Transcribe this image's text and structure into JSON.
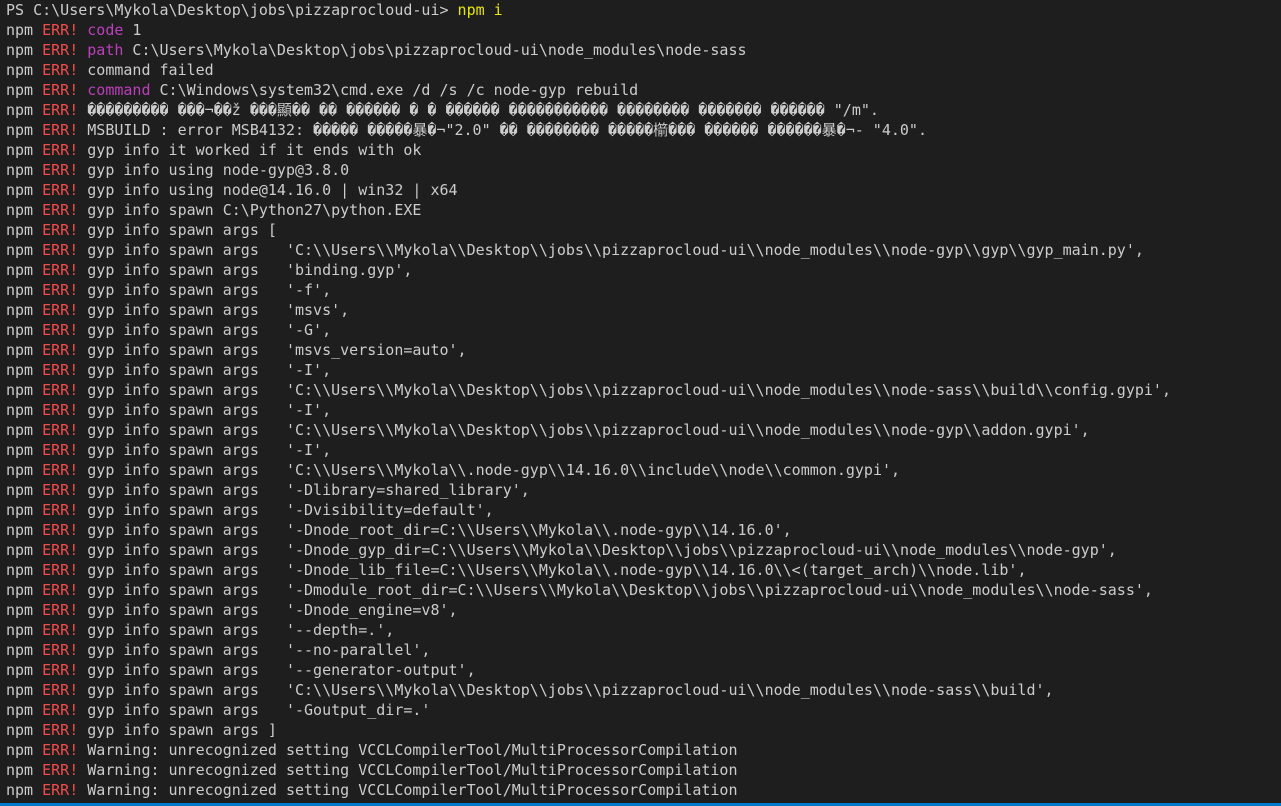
{
  "terminal": {
    "prompt": "PS C:\\Users\\Mykola\\Desktop\\jobs\\pizzaprocloud-ui> ",
    "command": "npm i",
    "colors": {
      "background": "#1e1e1e",
      "default": "#cccccc",
      "err": "#f14c4c",
      "keyword": "#bc3fbc",
      "cmd": "#e5e510",
      "statusbar": "#007acc"
    },
    "lines": [
      [
        {
          "t": "PS C:\\Users\\Mykola\\Desktop\\jobs\\pizzaprocloud-ui> ",
          "c": "default"
        },
        {
          "t": "npm i",
          "c": "cmd"
        }
      ],
      [
        {
          "t": "npm ",
          "c": "default"
        },
        {
          "t": "ERR!",
          "c": "err"
        },
        {
          "t": " ",
          "c": "default"
        },
        {
          "t": "code",
          "c": "keyword"
        },
        {
          "t": " 1",
          "c": "default"
        }
      ],
      [
        {
          "t": "npm ",
          "c": "default"
        },
        {
          "t": "ERR!",
          "c": "err"
        },
        {
          "t": " ",
          "c": "default"
        },
        {
          "t": "path",
          "c": "keyword"
        },
        {
          "t": " C:\\Users\\Mykola\\Desktop\\jobs\\pizzaprocloud-ui\\node_modules\\node-sass",
          "c": "default"
        }
      ],
      [
        {
          "t": "npm ",
          "c": "default"
        },
        {
          "t": "ERR!",
          "c": "err"
        },
        {
          "t": " command failed",
          "c": "default"
        }
      ],
      [
        {
          "t": "npm ",
          "c": "default"
        },
        {
          "t": "ERR!",
          "c": "err"
        },
        {
          "t": " ",
          "c": "default"
        },
        {
          "t": "command",
          "c": "keyword"
        },
        {
          "t": " C:\\Windows\\system32\\cmd.exe /d /s /c node-gyp rebuild",
          "c": "default"
        }
      ],
      [
        {
          "t": "npm ",
          "c": "default"
        },
        {
          "t": "ERR!",
          "c": "err"
        },
        {
          "t": " ��������� ���¬��ž ���顯�� �� ������ � � ������ ����������� �������� ������� ������ \"/m\".",
          "c": "default"
        }
      ],
      [
        {
          "t": "npm ",
          "c": "default"
        },
        {
          "t": "ERR!",
          "c": "err"
        },
        {
          "t": " MSBUILD : error MSB4132: ����� �����暴�¬\"2.0\" �� �������� �����櫤��� ������ ������暴�¬- \"4.0\".",
          "c": "default"
        }
      ],
      [
        {
          "t": "npm ",
          "c": "default"
        },
        {
          "t": "ERR!",
          "c": "err"
        },
        {
          "t": " gyp info it worked if it ends with ok",
          "c": "default"
        }
      ],
      [
        {
          "t": "npm ",
          "c": "default"
        },
        {
          "t": "ERR!",
          "c": "err"
        },
        {
          "t": " gyp info using node-gyp@3.8.0",
          "c": "default"
        }
      ],
      [
        {
          "t": "npm ",
          "c": "default"
        },
        {
          "t": "ERR!",
          "c": "err"
        },
        {
          "t": " gyp info using node@14.16.0 | win32 | x64",
          "c": "default"
        }
      ],
      [
        {
          "t": "npm ",
          "c": "default"
        },
        {
          "t": "ERR!",
          "c": "err"
        },
        {
          "t": " gyp info spawn C:\\Python27\\python.EXE",
          "c": "default"
        }
      ],
      [
        {
          "t": "npm ",
          "c": "default"
        },
        {
          "t": "ERR!",
          "c": "err"
        },
        {
          "t": " gyp info spawn args [",
          "c": "default"
        }
      ],
      [
        {
          "t": "npm ",
          "c": "default"
        },
        {
          "t": "ERR!",
          "c": "err"
        },
        {
          "t": " gyp info spawn args   'C:\\\\Users\\\\Mykola\\\\Desktop\\\\jobs\\\\pizzaprocloud-ui\\\\node_modules\\\\node-gyp\\\\gyp\\\\gyp_main.py',",
          "c": "default"
        }
      ],
      [
        {
          "t": "npm ",
          "c": "default"
        },
        {
          "t": "ERR!",
          "c": "err"
        },
        {
          "t": " gyp info spawn args   'binding.gyp',",
          "c": "default"
        }
      ],
      [
        {
          "t": "npm ",
          "c": "default"
        },
        {
          "t": "ERR!",
          "c": "err"
        },
        {
          "t": " gyp info spawn args   '-f',",
          "c": "default"
        }
      ],
      [
        {
          "t": "npm ",
          "c": "default"
        },
        {
          "t": "ERR!",
          "c": "err"
        },
        {
          "t": " gyp info spawn args   'msvs',",
          "c": "default"
        }
      ],
      [
        {
          "t": "npm ",
          "c": "default"
        },
        {
          "t": "ERR!",
          "c": "err"
        },
        {
          "t": " gyp info spawn args   '-G',",
          "c": "default"
        }
      ],
      [
        {
          "t": "npm ",
          "c": "default"
        },
        {
          "t": "ERR!",
          "c": "err"
        },
        {
          "t": " gyp info spawn args   'msvs_version=auto',",
          "c": "default"
        }
      ],
      [
        {
          "t": "npm ",
          "c": "default"
        },
        {
          "t": "ERR!",
          "c": "err"
        },
        {
          "t": " gyp info spawn args   '-I',",
          "c": "default"
        }
      ],
      [
        {
          "t": "npm ",
          "c": "default"
        },
        {
          "t": "ERR!",
          "c": "err"
        },
        {
          "t": " gyp info spawn args   'C:\\\\Users\\\\Mykola\\\\Desktop\\\\jobs\\\\pizzaprocloud-ui\\\\node_modules\\\\node-sass\\\\build\\\\config.gypi',",
          "c": "default"
        }
      ],
      [
        {
          "t": "npm ",
          "c": "default"
        },
        {
          "t": "ERR!",
          "c": "err"
        },
        {
          "t": " gyp info spawn args   '-I',",
          "c": "default"
        }
      ],
      [
        {
          "t": "npm ",
          "c": "default"
        },
        {
          "t": "ERR!",
          "c": "err"
        },
        {
          "t": " gyp info spawn args   'C:\\\\Users\\\\Mykola\\\\Desktop\\\\jobs\\\\pizzaprocloud-ui\\\\node_modules\\\\node-gyp\\\\addon.gypi',",
          "c": "default"
        }
      ],
      [
        {
          "t": "npm ",
          "c": "default"
        },
        {
          "t": "ERR!",
          "c": "err"
        },
        {
          "t": " gyp info spawn args   '-I',",
          "c": "default"
        }
      ],
      [
        {
          "t": "npm ",
          "c": "default"
        },
        {
          "t": "ERR!",
          "c": "err"
        },
        {
          "t": " gyp info spawn args   'C:\\\\Users\\\\Mykola\\\\.node-gyp\\\\14.16.0\\\\include\\\\node\\\\common.gypi',",
          "c": "default"
        }
      ],
      [
        {
          "t": "npm ",
          "c": "default"
        },
        {
          "t": "ERR!",
          "c": "err"
        },
        {
          "t": " gyp info spawn args   '-Dlibrary=shared_library',",
          "c": "default"
        }
      ],
      [
        {
          "t": "npm ",
          "c": "default"
        },
        {
          "t": "ERR!",
          "c": "err"
        },
        {
          "t": " gyp info spawn args   '-Dvisibility=default',",
          "c": "default"
        }
      ],
      [
        {
          "t": "npm ",
          "c": "default"
        },
        {
          "t": "ERR!",
          "c": "err"
        },
        {
          "t": " gyp info spawn args   '-Dnode_root_dir=C:\\\\Users\\\\Mykola\\\\.node-gyp\\\\14.16.0',",
          "c": "default"
        }
      ],
      [
        {
          "t": "npm ",
          "c": "default"
        },
        {
          "t": "ERR!",
          "c": "err"
        },
        {
          "t": " gyp info spawn args   '-Dnode_gyp_dir=C:\\\\Users\\\\Mykola\\\\Desktop\\\\jobs\\\\pizzaprocloud-ui\\\\node_modules\\\\node-gyp',",
          "c": "default"
        }
      ],
      [
        {
          "t": "npm ",
          "c": "default"
        },
        {
          "t": "ERR!",
          "c": "err"
        },
        {
          "t": " gyp info spawn args   '-Dnode_lib_file=C:\\\\Users\\\\Mykola\\\\.node-gyp\\\\14.16.0\\\\<(target_arch)\\\\node.lib',",
          "c": "default"
        }
      ],
      [
        {
          "t": "npm ",
          "c": "default"
        },
        {
          "t": "ERR!",
          "c": "err"
        },
        {
          "t": " gyp info spawn args   '-Dmodule_root_dir=C:\\\\Users\\\\Mykola\\\\Desktop\\\\jobs\\\\pizzaprocloud-ui\\\\node_modules\\\\node-sass',",
          "c": "default"
        }
      ],
      [
        {
          "t": "npm ",
          "c": "default"
        },
        {
          "t": "ERR!",
          "c": "err"
        },
        {
          "t": " gyp info spawn args   '-Dnode_engine=v8',",
          "c": "default"
        }
      ],
      [
        {
          "t": "npm ",
          "c": "default"
        },
        {
          "t": "ERR!",
          "c": "err"
        },
        {
          "t": " gyp info spawn args   '--depth=.',",
          "c": "default"
        }
      ],
      [
        {
          "t": "npm ",
          "c": "default"
        },
        {
          "t": "ERR!",
          "c": "err"
        },
        {
          "t": " gyp info spawn args   '--no-parallel',",
          "c": "default"
        }
      ],
      [
        {
          "t": "npm ",
          "c": "default"
        },
        {
          "t": "ERR!",
          "c": "err"
        },
        {
          "t": " gyp info spawn args   '--generator-output',",
          "c": "default"
        }
      ],
      [
        {
          "t": "npm ",
          "c": "default"
        },
        {
          "t": "ERR!",
          "c": "err"
        },
        {
          "t": " gyp info spawn args   'C:\\\\Users\\\\Mykola\\\\Desktop\\\\jobs\\\\pizzaprocloud-ui\\\\node_modules\\\\node-sass\\\\build',",
          "c": "default"
        }
      ],
      [
        {
          "t": "npm ",
          "c": "default"
        },
        {
          "t": "ERR!",
          "c": "err"
        },
        {
          "t": " gyp info spawn args   '-Goutput_dir=.'",
          "c": "default"
        }
      ],
      [
        {
          "t": "npm ",
          "c": "default"
        },
        {
          "t": "ERR!",
          "c": "err"
        },
        {
          "t": " gyp info spawn args ]",
          "c": "default"
        }
      ],
      [
        {
          "t": "npm ",
          "c": "default"
        },
        {
          "t": "ERR!",
          "c": "err"
        },
        {
          "t": " Warning: unrecognized setting VCCLCompilerTool/MultiProcessorCompilation",
          "c": "default"
        }
      ],
      [
        {
          "t": "npm ",
          "c": "default"
        },
        {
          "t": "ERR!",
          "c": "err"
        },
        {
          "t": " Warning: unrecognized setting VCCLCompilerTool/MultiProcessorCompilation",
          "c": "default"
        }
      ],
      [
        {
          "t": "npm ",
          "c": "default"
        },
        {
          "t": "ERR!",
          "c": "err"
        },
        {
          "t": " Warning: unrecognized setting VCCLCompilerTool/MultiProcessorCompilation",
          "c": "default"
        }
      ]
    ]
  }
}
